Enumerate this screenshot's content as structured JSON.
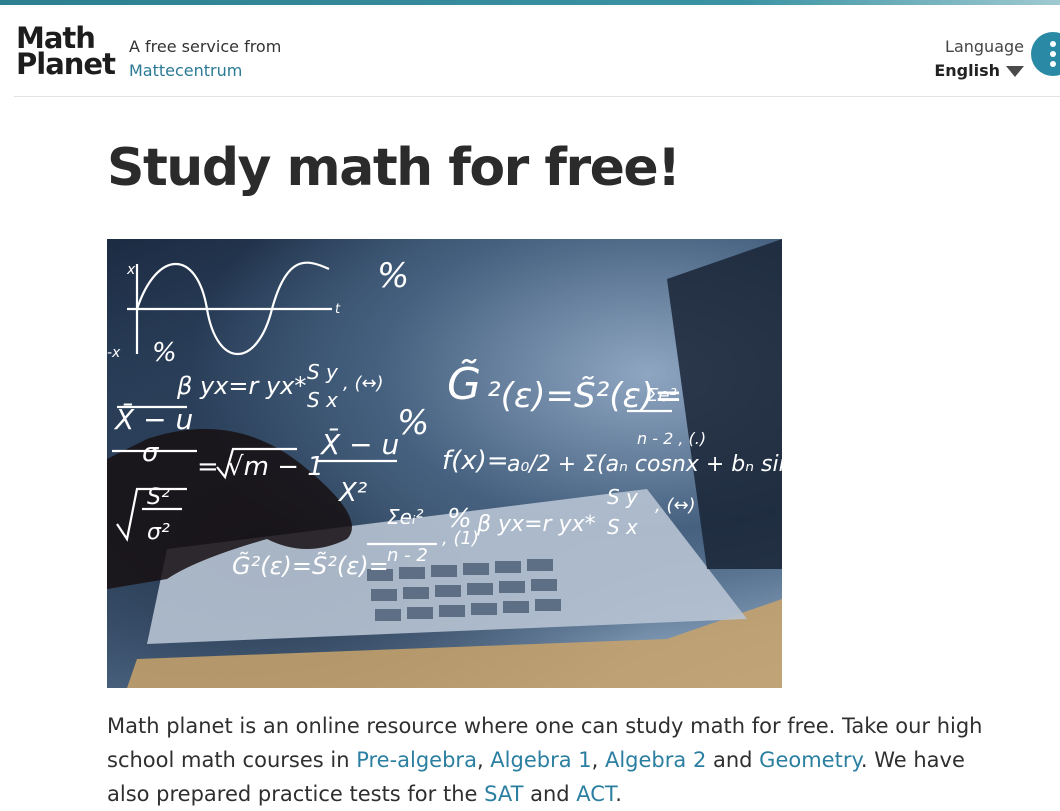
{
  "header": {
    "logo_line1": "Math",
    "logo_line2": "Planet",
    "tagline": "A free service from",
    "tagline_link": "Mattecentrum",
    "language_label": "Language",
    "language_value": "English"
  },
  "main": {
    "title": "Study math for free!",
    "hero_alt": "Laptop with math formulas",
    "intro": {
      "p1": "Math planet is an online resource where one can study math for free. Take our high school math courses in ",
      "link1": "Pre-algebra",
      "sep1": ", ",
      "link2": "Algebra 1",
      "sep2": ", ",
      "link3": "Algebra 2",
      "sep3": " and ",
      "link4": "Geometry",
      "p2": ". We have also prepared practice tests for the ",
      "link5": "SAT",
      "sep4": " and ",
      "link6": "ACT",
      "p3": "."
    }
  },
  "colors": {
    "accent": "#2b7a95",
    "link": "#2b7fa1",
    "menu": "#2a8aa5"
  }
}
